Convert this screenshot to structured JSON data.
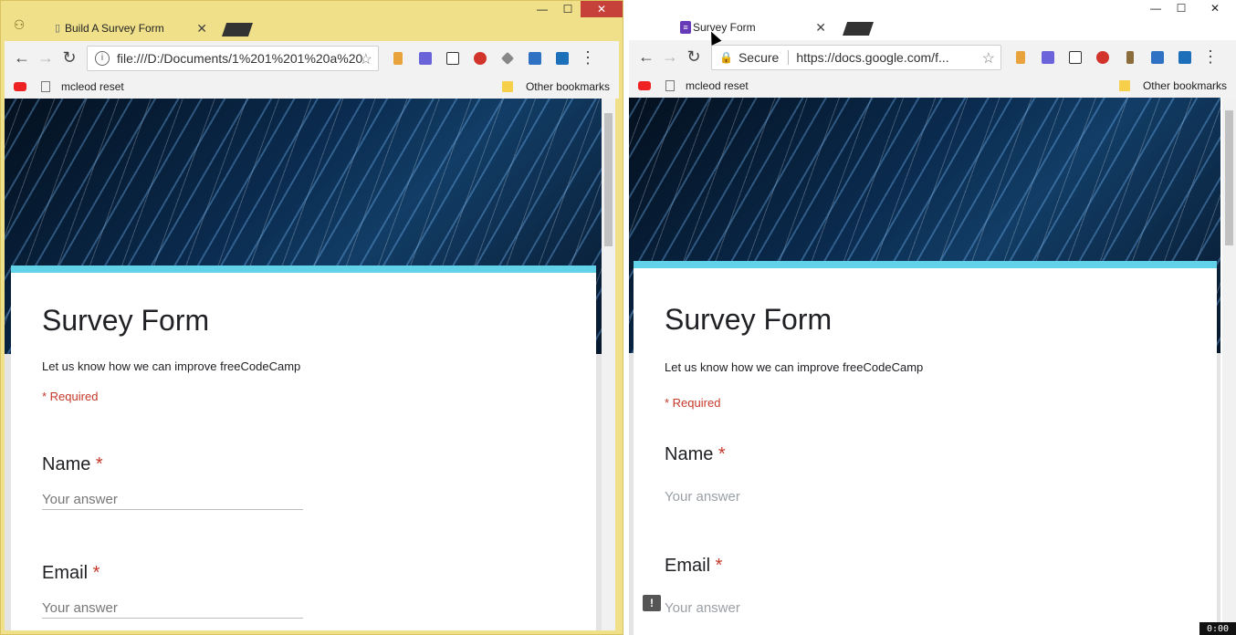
{
  "left_window": {
    "tab_title": "Build A Survey Form",
    "tab_close": "✕",
    "url": "file:///D:/Documents/1%201%201%20a%20",
    "bookmarks": [
      "mcleod reset"
    ],
    "other_bookmarks": "Other bookmarks",
    "form": {
      "title": "Survey Form",
      "description": "Let us know how we can improve freeCodeCamp",
      "required_note": "* Required",
      "questions": [
        {
          "label": "Name",
          "required_mark": "*",
          "placeholder": "Your answer"
        },
        {
          "label": "Email",
          "required_mark": "*",
          "placeholder": "Your answer"
        }
      ]
    }
  },
  "right_window": {
    "tab_title": "Survey Form",
    "tab_close": "✕",
    "secure_label": "Secure",
    "url": "https://docs.google.com/f...",
    "bookmarks": [
      "mcleod reset"
    ],
    "other_bookmarks": "Other bookmarks",
    "form": {
      "title": "Survey Form",
      "description": "Let us know how we can improve freeCodeCamp",
      "required_note": "* Required",
      "questions": [
        {
          "label": "Name",
          "required_mark": "*",
          "placeholder": "Your answer"
        },
        {
          "label": "Email",
          "required_mark": "*",
          "placeholder": "Your answer"
        }
      ]
    }
  },
  "window_controls": {
    "minimize": "—",
    "maximize": "☐",
    "close": "✕"
  },
  "nav": {
    "back": "←",
    "forward": "→",
    "reload": "↻",
    "menu": "⋮",
    "star": "☆",
    "info": "i",
    "lock": "🔒"
  },
  "feedback_icon": "!",
  "timer": "0:00"
}
